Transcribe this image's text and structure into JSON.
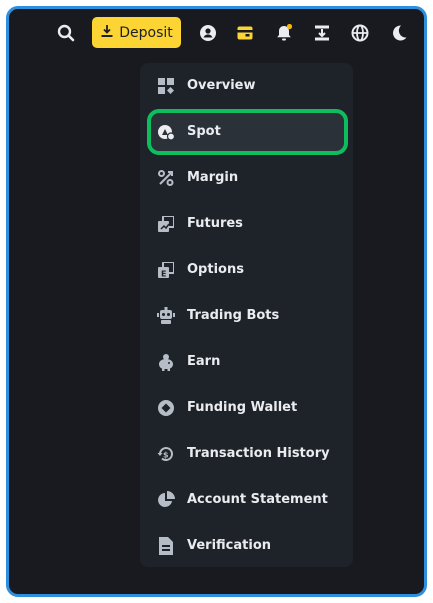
{
  "topbar": {
    "icons": [
      "search-icon",
      "user-icon",
      "wallet-icon",
      "notification-bell-icon",
      "download-app-icon",
      "language-globe-icon",
      "dark-mode-moon-icon"
    ],
    "deposit_label": "Deposit",
    "accent": "#fcd535"
  },
  "wallet_menu": {
    "items": [
      {
        "label": "Overview",
        "icon": "overview-grid-icon"
      },
      {
        "label": "Spot",
        "icon": "spot-icon",
        "selected": true
      },
      {
        "label": "Margin",
        "icon": "margin-percent-icon"
      },
      {
        "label": "Futures",
        "icon": "futures-icon"
      },
      {
        "label": "Options",
        "icon": "options-icon"
      },
      {
        "label": "Trading Bots",
        "icon": "robot-icon"
      },
      {
        "label": "Earn",
        "icon": "piggy-bank-icon"
      },
      {
        "label": "Funding Wallet",
        "icon": "funding-wallet-icon"
      },
      {
        "label": "Transaction History",
        "icon": "transaction-history-icon"
      },
      {
        "label": "Account Statement",
        "icon": "pie-chart-icon"
      },
      {
        "label": "Verification",
        "icon": "document-icon"
      }
    ],
    "highlight_color": "#0ebe5e"
  }
}
